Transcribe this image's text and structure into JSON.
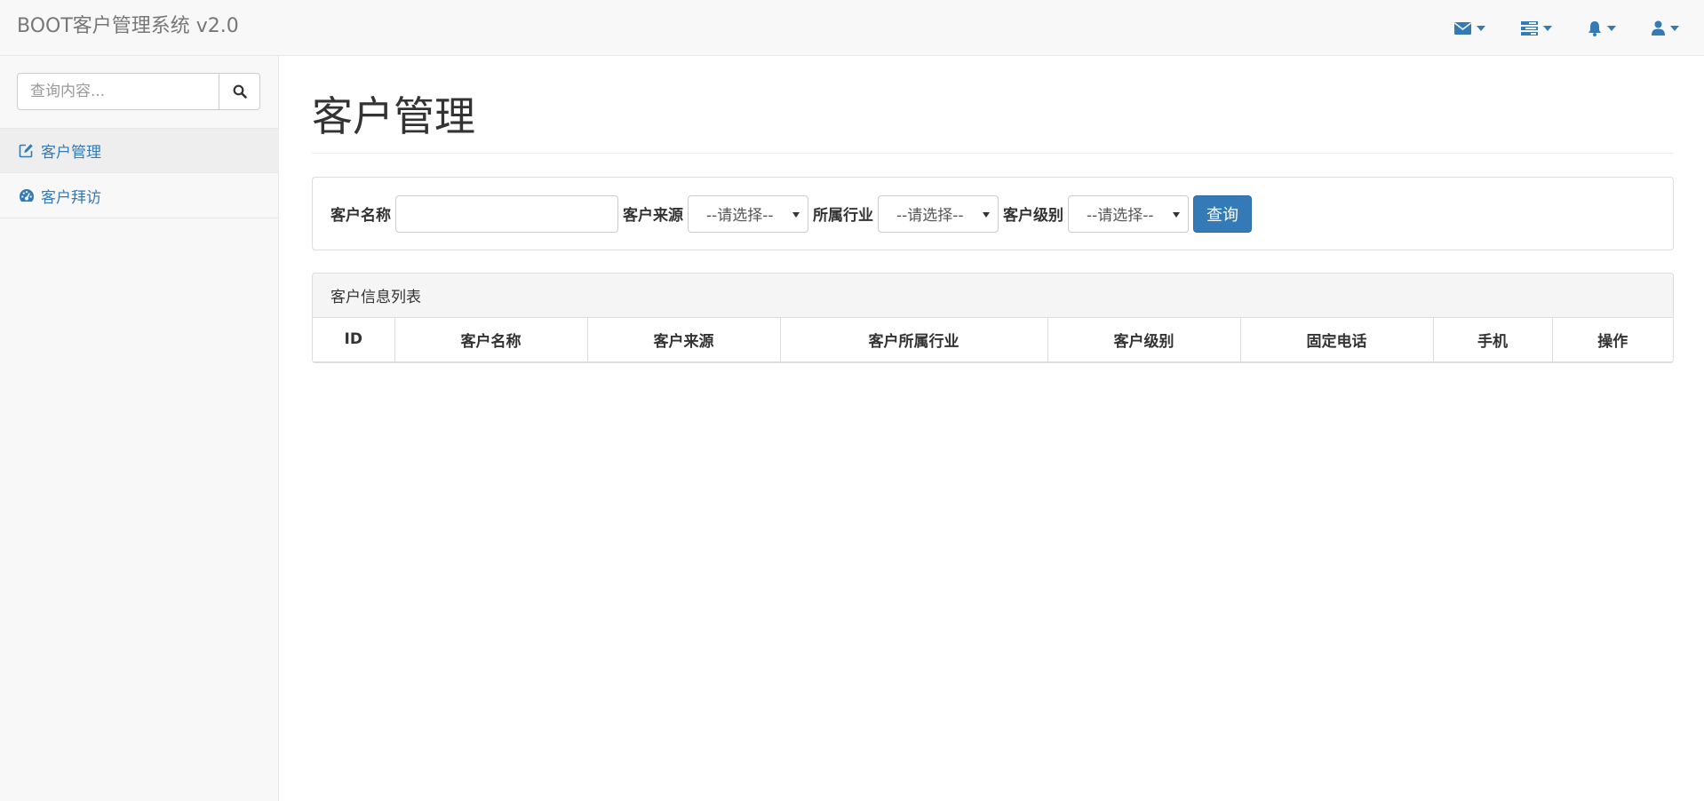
{
  "header": {
    "brand": "BOOT客户管理系统 v2.0",
    "nav_icons": [
      "envelope-icon",
      "tasks-icon",
      "bell-icon",
      "user-icon"
    ],
    "accent_color": "#337ab7"
  },
  "sidebar": {
    "search": {
      "placeholder": "查询内容...",
      "value": ""
    },
    "items": [
      {
        "label": "客户管理",
        "icon": "edit-icon",
        "active": true
      },
      {
        "label": "客户拜访",
        "icon": "dashboard-icon",
        "active": false
      }
    ]
  },
  "main": {
    "page_title": "客户管理",
    "filters": {
      "name_label": "客户名称",
      "name_value": "",
      "source_label": "客户来源",
      "source_value": "--请选择--",
      "industry_label": "所属行业",
      "industry_value": "--请选择--",
      "level_label": "客户级别",
      "level_value": "--请选择--",
      "query_button": "查询"
    },
    "table": {
      "heading": "客户信息列表",
      "columns": [
        "ID",
        "客户名称",
        "客户来源",
        "客户所属行业",
        "客户级别",
        "固定电话",
        "手机",
        "操作"
      ],
      "rows": []
    }
  }
}
